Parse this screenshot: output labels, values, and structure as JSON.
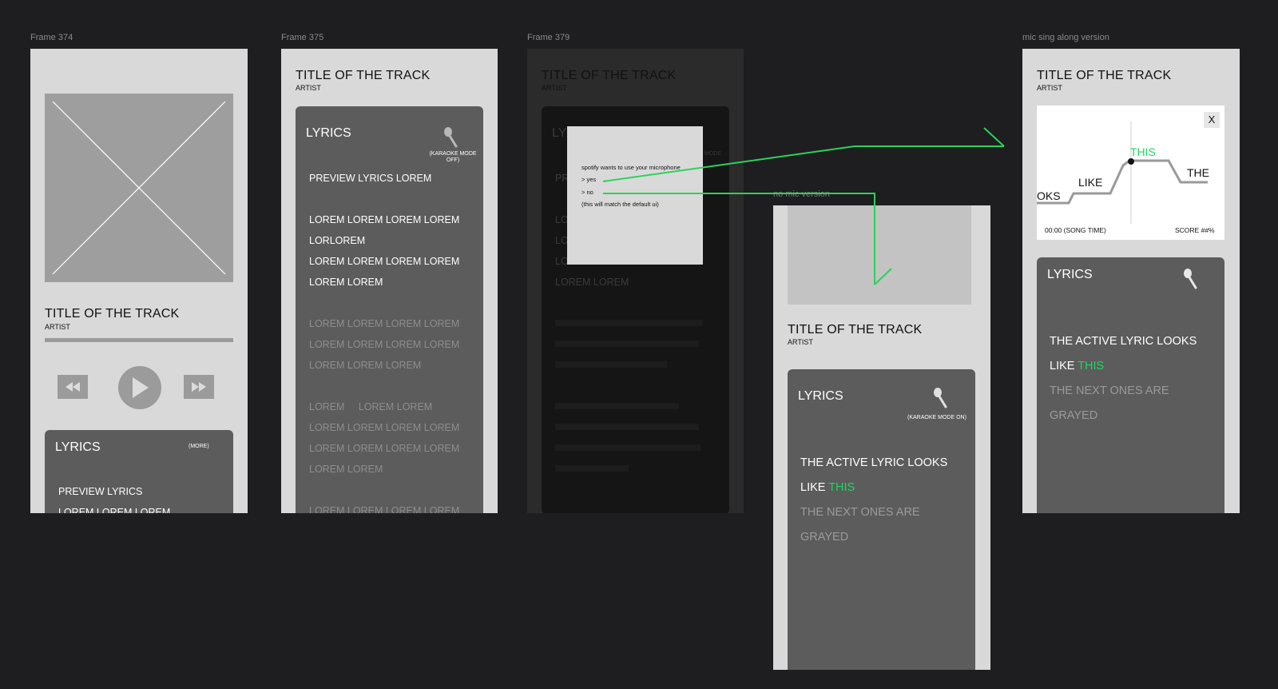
{
  "frames": {
    "f374": {
      "label": "Frame 374",
      "title": "TITLE OF THE TRACK",
      "artist": "ARTIST",
      "lyrics_title": "LYRICS",
      "more": "(MORE)",
      "preview_lines": [
        "PREVIEW LYRICS",
        "LOREM LOREM LOREM"
      ]
    },
    "f375": {
      "label": "Frame 375",
      "title": "TITLE OF THE TRACK",
      "artist": "ARTIST",
      "lyrics_title": "LYRICS",
      "karaoke_label_1": "(KARAOKE MODE",
      "karaoke_label_2": "OFF)",
      "lines": [
        "PREVIEW LYRICS LOREM",
        "LOREM LOREM LOREM LOREM",
        "LORLOREM",
        "LOREM LOREM LOREM LOREM",
        "LOREM LOREM",
        "LOREM LOREM LOREM LOREM",
        "LOREM LOREM LOREM LOREM",
        "LOREM LOREM LOREM",
        "LOREM     LOREM LOREM",
        "LOREM LOREM LOREM LOREM",
        "LOREM LOREM LOREM LOREM",
        "LOREM LOREM",
        "LOREM LOREM LOREM LOREM"
      ]
    },
    "f379": {
      "label": "Frame 379",
      "title": "TITLE OF THE TRACK",
      "artist": "ARTIST",
      "lyrics_partial": "LY",
      "mode_partial": "MODE",
      "partial_lines": [
        "PR",
        "LO",
        "LO",
        "LO",
        "LOREM LOREM"
      ],
      "dialog": {
        "message": "spotify wants to use your microphone",
        "yes": "> yes",
        "no": "> no",
        "note": "(this will match the default ui)"
      }
    },
    "nomic": {
      "label": "no mic version",
      "title": "TITLE OF THE TRACK",
      "artist": "ARTIST",
      "lyrics_title": "LYRICS",
      "karaoke_label": "(KARAOKE MODE ON)",
      "active_line_1": "THE ACTIVE LYRIC LOOKS",
      "active_line_2_prefix": "LIKE ",
      "active_word": "THIS",
      "next_line_1": "THE NEXT ONES ARE",
      "next_line_2": "GRAYED"
    },
    "mic": {
      "label": "mic sing along version",
      "title": "TITLE OF THE TRACK",
      "artist": "ARTIST",
      "close": "X",
      "graph_words": [
        "OKS",
        "LIKE",
        "THIS",
        "THE"
      ],
      "song_time": "00:00 (SONG TIME)",
      "score": "SCORE ##%",
      "lyrics_title": "LYRICS",
      "active_line_1": "THE ACTIVE LYRIC LOOKS",
      "active_line_2_prefix": "LIKE ",
      "active_word": "THIS",
      "next_line_1": "THE NEXT ONES ARE",
      "next_line_2": "GRAYED"
    }
  },
  "icons": {
    "mic": "microphone-icon",
    "prev": "rewind-icon",
    "play": "play-icon",
    "next": "fast-forward-icon"
  },
  "colors": {
    "canvas": "#1e1e20",
    "frame": "#d9d9d9",
    "card": "#5c5c5c",
    "accent": "#1ed760"
  }
}
